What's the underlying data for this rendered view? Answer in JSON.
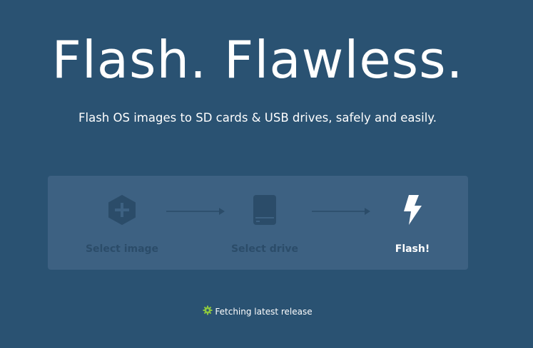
{
  "hero": {
    "title": "Flash. Flawless.",
    "subtitle": "Flash OS images to SD cards & USB drives, safely and easily."
  },
  "steps": [
    {
      "label": "Select image",
      "icon": "hexagon-plus-icon",
      "state": "disabled"
    },
    {
      "label": "Select drive",
      "icon": "drive-icon",
      "state": "disabled"
    },
    {
      "label": "Flash!",
      "icon": "lightning-bolt-icon",
      "state": "active"
    }
  ],
  "connector_icon": "arrow-right-icon",
  "status": {
    "icon": "gear-icon",
    "text": "Fetching latest release"
  },
  "colors": {
    "background": "#2a5272",
    "card": "#3d6182",
    "disabled": "#2b4c69",
    "active": "#ffffff",
    "status_icon": "#8cc63f"
  }
}
